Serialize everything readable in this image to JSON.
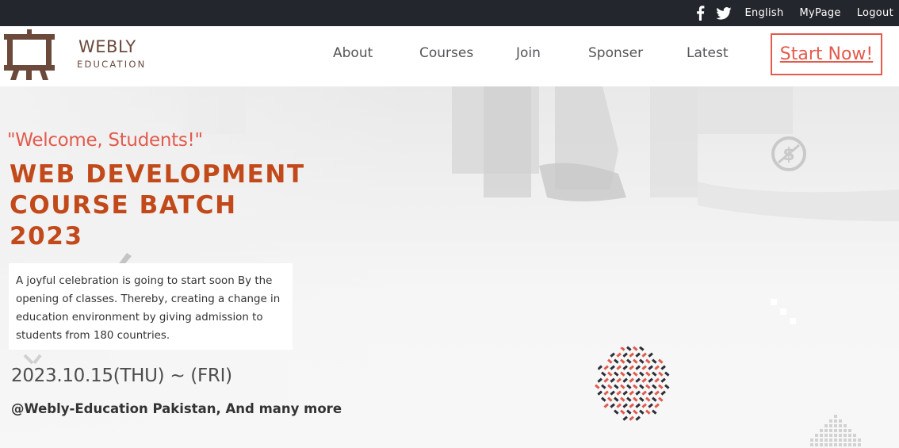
{
  "topbar": {
    "social": [
      "facebook-icon",
      "twitter-icon"
    ],
    "links": [
      "English",
      "MyPage",
      "Logout"
    ]
  },
  "header": {
    "brand_name": "WEBLY",
    "brand_sub": "EDUCATION",
    "nav": [
      "About",
      "Courses",
      "Join",
      "Sponser",
      "Latest"
    ],
    "cta": "Start Now!"
  },
  "hero": {
    "welcome": "\"Welcome, Students!\"",
    "headline": [
      "WEB DEVELOPMENT",
      "COURSE BATCH",
      "2023"
    ],
    "description": "A joyful celebration is going to start soon By the opening of classes. Thereby, creating a change in education environment by giving admission to students from 180 countries.",
    "date": "2023.10.15(THU) ~ (FRI)",
    "venue": "@Webly-Education Pakistan, And many more"
  },
  "colors": {
    "accent": "#e25b4d",
    "headline": "#c24a1a",
    "brand": "#6b4a3c",
    "topbar": "#24262d"
  }
}
